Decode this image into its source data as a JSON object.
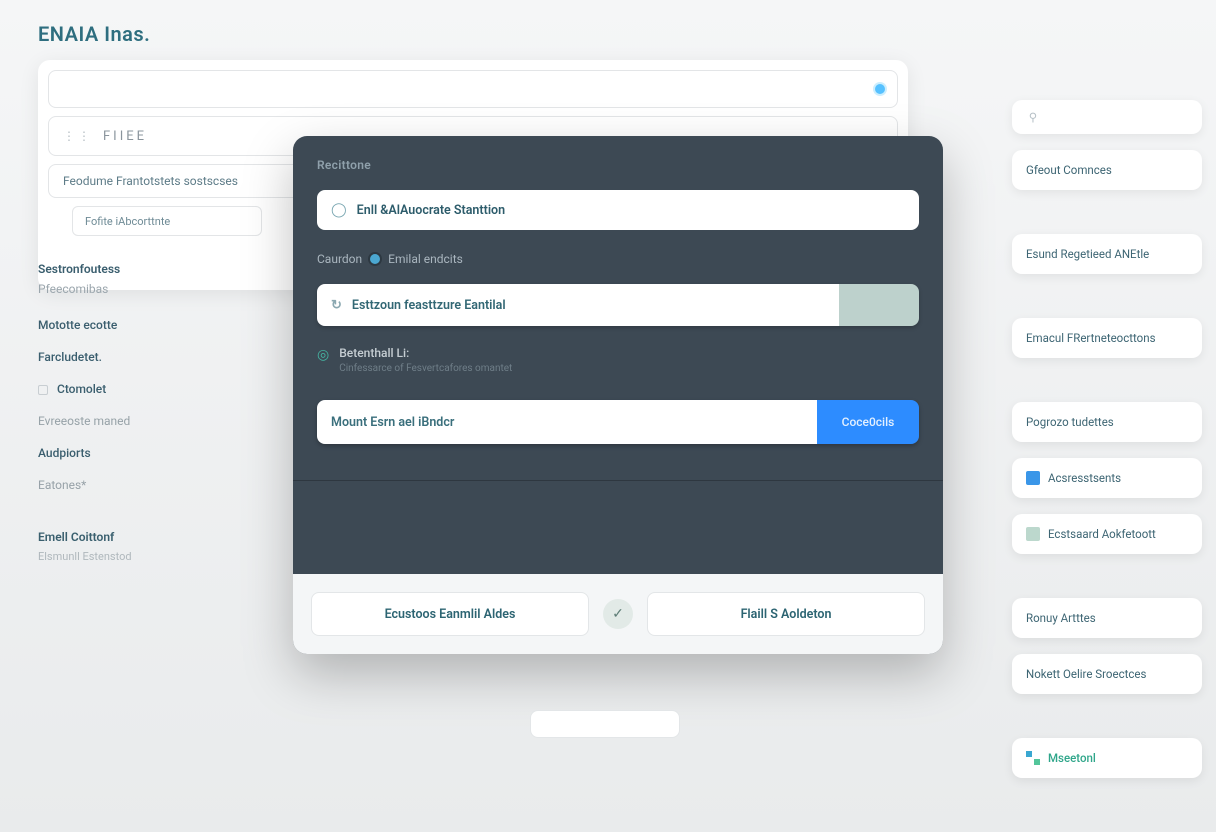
{
  "page": {
    "title": "ENAIA Inas."
  },
  "toolbar": {
    "filter_label": "FIIEE",
    "sub_label": "Feodume Frantotstets sostscses",
    "chip_label": "Fofite iAbcorttnte"
  },
  "sidebar": {
    "heading": "Sestronfoutess",
    "sub": "Pfeecomibas",
    "items": [
      {
        "label": "Mototte ecotte",
        "dim": false
      },
      "",
      {
        "label": "Farcludetet.",
        "dim": false
      },
      "",
      {
        "label": "Ctomolet",
        "dim": false,
        "check": true
      },
      "",
      {
        "label": "Evreeoste maned",
        "dim": true
      },
      {
        "label": "Audpiorts",
        "dim": false
      },
      "",
      {
        "label": "Eatones*",
        "dim": true
      }
    ],
    "section": "Emell Coittonf",
    "section_sub": "Elsmunll Estenstod"
  },
  "modal": {
    "title": "Recittone",
    "search_text": "Enll &AlAuocrate Stanttion",
    "label_left": "Caurdon",
    "label_right": "Emilal endcits",
    "feature_text": "Esttzoun feasttzure Eantilal",
    "info_title": "Betenthall  Li:",
    "info_sub": "Cinfessarce of Fesvertcafores omantet",
    "action_placeholder": "Mount Esrn ael iBndcr",
    "action_button": "Coce0cils",
    "footer": {
      "left": "Ecustoos Eanmlil Aldes",
      "right": "Flaill S Aoldeton"
    }
  },
  "rightcol": {
    "items": [
      {
        "label": "",
        "icon": "pale"
      },
      {
        "label": "Gfeout Comnces"
      },
      "gap",
      {
        "label": "Esund Regetieed ANEtle"
      },
      "gap",
      {
        "label": "Emacul FRertneteocttons"
      },
      "gap",
      {
        "label": "Pogrozo tudettes"
      },
      {
        "label": "Acsresstsents",
        "icon": "blue"
      },
      {
        "label": "Ecstsaard Aokfetoott",
        "icon": "green"
      },
      "gap",
      {
        "label": "Ronuy Artttes"
      },
      {
        "label": "Nokett Oelire Sroectces"
      },
      "gap",
      {
        "label": "Mseetonl",
        "brand": true
      }
    ]
  }
}
